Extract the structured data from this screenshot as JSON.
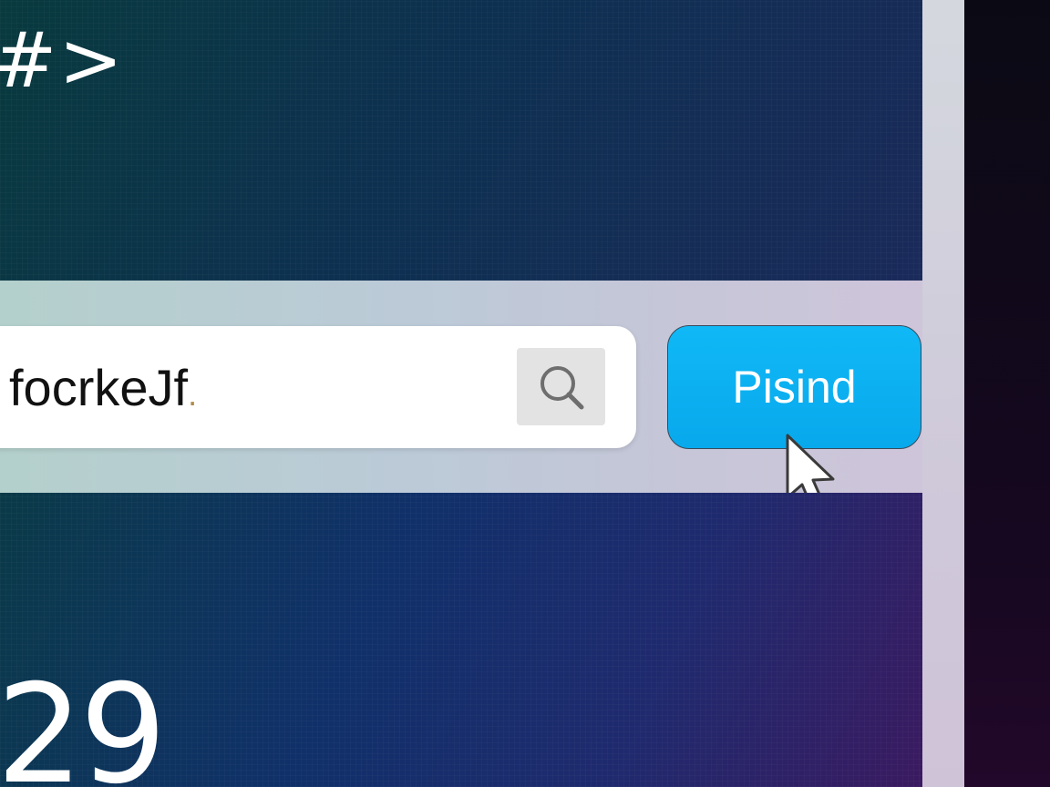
{
  "prompt": {
    "symbol": "#>"
  },
  "search": {
    "value": "focrkeJf",
    "trailing_char": ".",
    "icon": "search-icon"
  },
  "primary_button": {
    "label": "Pisind"
  },
  "bottom": {
    "number": "29"
  },
  "colors": {
    "button_fill": "#08a9ec",
    "panel_top": "#0d3050",
    "panel_bottom": "#10306a",
    "band": "#bccad8"
  },
  "cursor": {
    "icon": "arrow-cursor-icon"
  }
}
